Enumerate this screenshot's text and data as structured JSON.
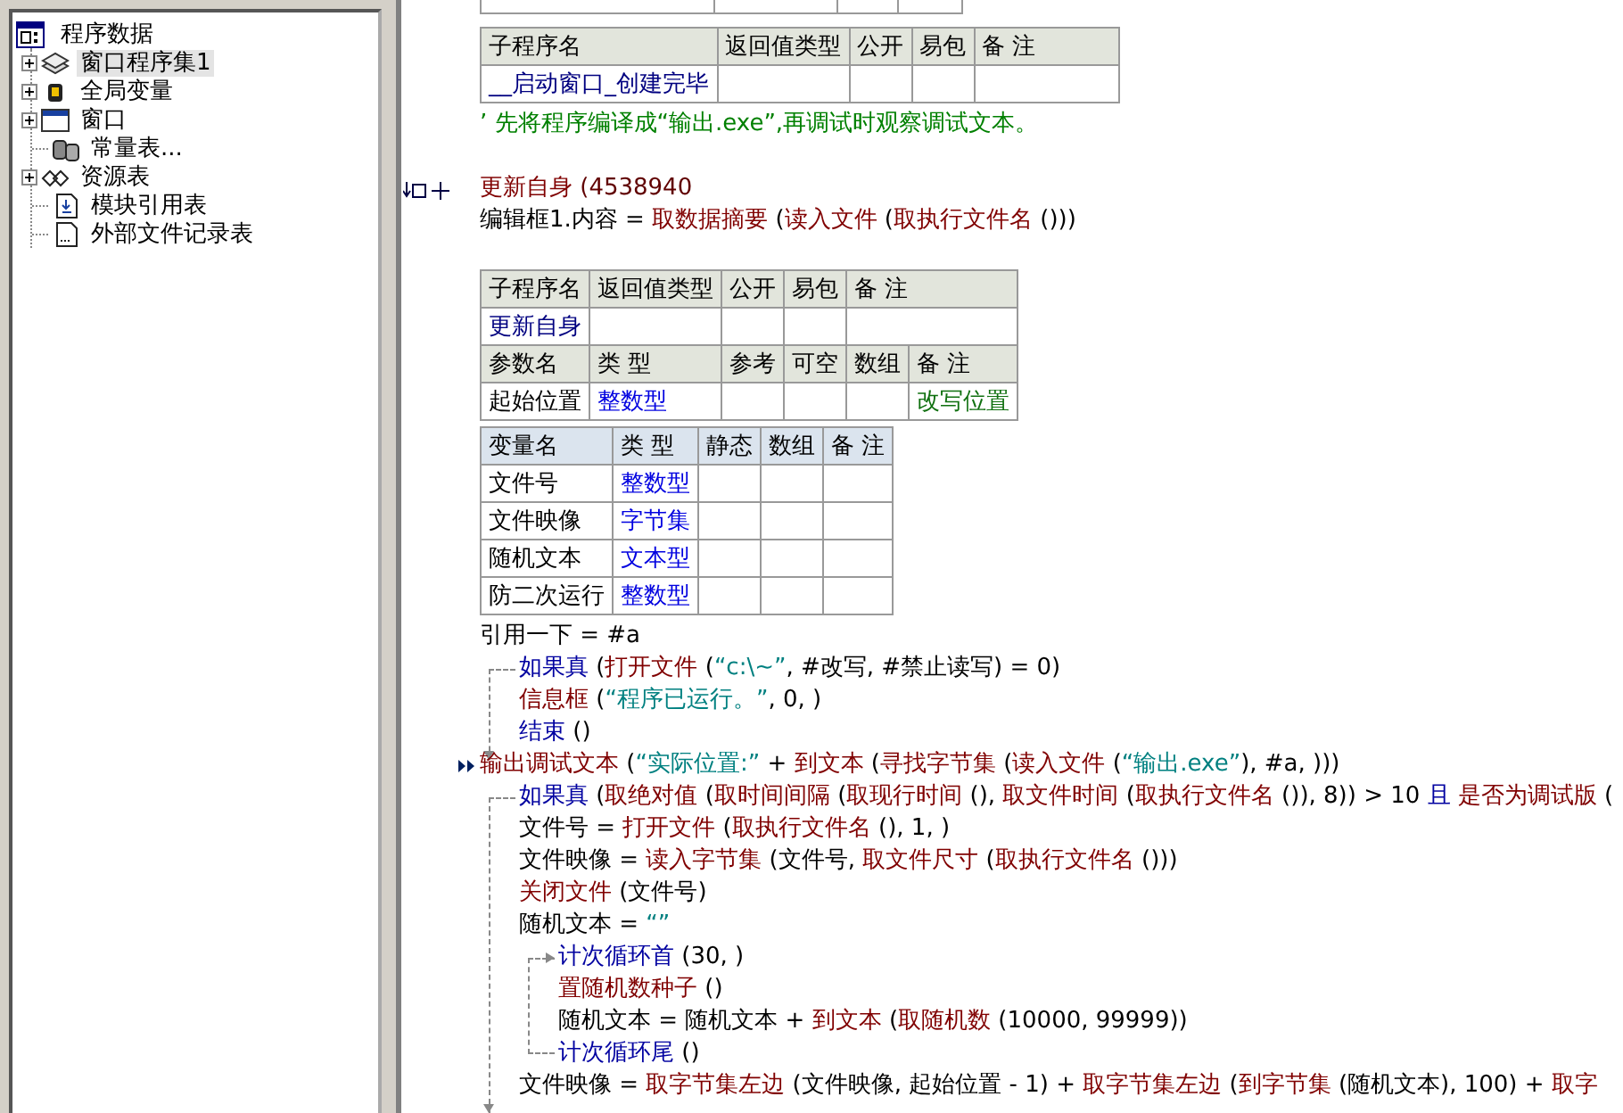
{
  "tree": {
    "root": "程序数据",
    "items": [
      {
        "label": "窗口程序集1",
        "kind": "module",
        "expandable": true,
        "selected": true
      },
      {
        "label": "全局变量",
        "kind": "variable",
        "expandable": true,
        "selected": false
      },
      {
        "label": "窗口",
        "kind": "window",
        "expandable": true,
        "selected": false
      },
      {
        "label": "常量表...",
        "kind": "constant",
        "expandable": false,
        "selected": false
      },
      {
        "label": "资源表",
        "kind": "resource",
        "expandable": true,
        "selected": false
      },
      {
        "label": "模块引用表",
        "kind": "reference",
        "expandable": false,
        "selected": false
      },
      {
        "label": "外部文件记录表",
        "kind": "file",
        "expandable": false,
        "selected": false
      }
    ]
  },
  "editor": [
    {
      "kind": "subroutine_table",
      "rows": [
        {
          "kind": "header",
          "cells": [
            {
              "text": "子程序名"
            },
            {
              "text": "返回值类型"
            },
            {
              "text": "公开"
            },
            {
              "text": "易包"
            },
            {
              "text": "备 注"
            }
          ]
        },
        {
          "kind": "data",
          "cells": [
            {
              "text": "__启动窗口_创建完毕",
              "kind": "name"
            },
            null,
            null,
            null,
            null
          ]
        }
      ]
    },
    {
      "kind": "line",
      "segments": [
        {
          "t": "’ 先将程序编译成“输出.exe”,再调试时观察调试文本。",
          "kind": "comment"
        }
      ]
    },
    {
      "kind": "blank"
    },
    {
      "kind": "line",
      "gutter": {
        "kind": "fold"
      },
      "segments": [
        {
          "t": "更新自身",
          "kind": "func"
        },
        {
          "t": " (4538940",
          "kind": "num"
        }
      ]
    },
    {
      "kind": "line",
      "segments": [
        {
          "t": "编辑框1.内容 = ",
          "kind": "plain"
        },
        {
          "t": "取数据摘要",
          "kind": "func"
        },
        {
          "t": " (",
          "kind": "plain"
        },
        {
          "t": "读入文件",
          "kind": "func"
        },
        {
          "t": " (",
          "kind": "plain"
        },
        {
          "t": "取执行文件名",
          "kind": "func"
        },
        {
          "t": " ()))",
          "kind": "plain"
        }
      ]
    },
    {
      "kind": "blank"
    },
    {
      "kind": "subroutine_table",
      "rows": [
        {
          "kind": "header",
          "cells": [
            {
              "text": "子程序名"
            },
            {
              "text": "返回值类型"
            },
            {
              "text": "公开"
            },
            {
              "text": "易包"
            },
            {
              "text": "备 注",
              "colspan": 2
            }
          ]
        },
        {
          "kind": "data",
          "cells": [
            {
              "text": "更新自身",
              "kind": "name"
            },
            null,
            null,
            null,
            {
              "colspan": 2
            }
          ]
        },
        {
          "kind": "header",
          "cells": [
            {
              "text": "参数名"
            },
            {
              "text": "类 型"
            },
            {
              "text": "参考"
            },
            {
              "text": "可空"
            },
            {
              "text": "数组"
            },
            {
              "text": "备 注"
            }
          ]
        },
        {
          "kind": "data",
          "cells": [
            {
              "text": "起始位置",
              "kind": "plain"
            },
            {
              "text": "整数型",
              "kind": "type"
            },
            null,
            null,
            null,
            {
              "text": "改写位置",
              "kind": "note"
            }
          ]
        }
      ]
    },
    {
      "kind": "variable_table",
      "rows": [
        {
          "kind": "header",
          "cells": [
            {
              "text": "变量名"
            },
            {
              "text": "类 型"
            },
            {
              "text": "静态"
            },
            {
              "text": "数组"
            },
            {
              "text": "备 注"
            }
          ]
        },
        {
          "kind": "data",
          "cells": [
            {
              "text": "文件号",
              "kind": "plain"
            },
            {
              "text": "整数型",
              "kind": "type"
            },
            null,
            null,
            null
          ]
        },
        {
          "kind": "data",
          "cells": [
            {
              "text": "文件映像",
              "kind": "plain"
            },
            {
              "text": "字节集",
              "kind": "type"
            },
            null,
            null,
            null
          ]
        },
        {
          "kind": "data",
          "cells": [
            {
              "text": "随机文本",
              "kind": "plain"
            },
            {
              "text": "文本型",
              "kind": "type"
            },
            null,
            null,
            null
          ]
        },
        {
          "kind": "data",
          "cells": [
            {
              "text": "防二次运行",
              "kind": "plain"
            },
            {
              "text": "整数型",
              "kind": "type"
            },
            null,
            null,
            null
          ]
        }
      ]
    },
    {
      "kind": "line",
      "segments": [
        {
          "t": "引用一下 = #a",
          "kind": "plain"
        }
      ]
    },
    {
      "kind": "if_block",
      "head": [
        {
          "t": "如果真",
          "kind": "flow"
        },
        {
          "t": " (",
          "kind": "plain"
        },
        {
          "t": "打开文件",
          "kind": "func"
        },
        {
          "t": " (",
          "kind": "plain"
        },
        {
          "t": "“c:\\~”",
          "kind": "str"
        },
        {
          "t": ", #改写, #禁止读写) = 0)",
          "kind": "plain"
        }
      ],
      "children": [
        {
          "kind": "line",
          "segments": [
            {
              "t": "信息框",
              "kind": "func"
            },
            {
              "t": " (",
              "kind": "plain"
            },
            {
              "t": "“程序已运行。”",
              "kind": "str"
            },
            {
              "t": ", 0, )",
              "kind": "plain"
            }
          ]
        },
        {
          "kind": "line",
          "segments": [
            {
              "t": "结束",
              "kind": "flow"
            },
            {
              "t": " ()",
              "kind": "plain"
            }
          ]
        }
      ]
    },
    {
      "kind": "line",
      "gutter": {
        "kind": "run"
      },
      "segments": [
        {
          "t": "输出调试文本",
          "kind": "func"
        },
        {
          "t": " (",
          "kind": "plain"
        },
        {
          "t": "“实际位置:”",
          "kind": "str"
        },
        {
          "t": " + ",
          "kind": "plain"
        },
        {
          "t": "到文本",
          "kind": "func"
        },
        {
          "t": " (",
          "kind": "plain"
        },
        {
          "t": "寻找字节集",
          "kind": "func"
        },
        {
          "t": " (",
          "kind": "plain"
        },
        {
          "t": "读入文件",
          "kind": "func"
        },
        {
          "t": " (",
          "kind": "plain"
        },
        {
          "t": "“输出.exe”",
          "kind": "str"
        },
        {
          "t": "), #a, )))",
          "kind": "plain"
        }
      ]
    },
    {
      "kind": "if_block",
      "head": [
        {
          "t": "如果真",
          "kind": "flow"
        },
        {
          "t": " (",
          "kind": "plain"
        },
        {
          "t": "取绝对值",
          "kind": "func"
        },
        {
          "t": " (",
          "kind": "plain"
        },
        {
          "t": "取时间间隔",
          "kind": "func"
        },
        {
          "t": " (",
          "kind": "plain"
        },
        {
          "t": "取现行时间",
          "kind": "func"
        },
        {
          "t": " (), ",
          "kind": "plain"
        },
        {
          "t": "取文件时间",
          "kind": "func"
        },
        {
          "t": " (",
          "kind": "plain"
        },
        {
          "t": "取执行文件名",
          "kind": "func"
        },
        {
          "t": " ()), 8)) > 10 ",
          "kind": "plain"
        },
        {
          "t": "且 ",
          "kind": "flow"
        },
        {
          "t": "是否为调试版",
          "kind": "func"
        },
        {
          "t": " (",
          "kind": "plain"
        }
      ],
      "children": [
        {
          "kind": "line",
          "segments": [
            {
              "t": "文件号 = ",
              "kind": "plain"
            },
            {
              "t": "打开文件",
              "kind": "func"
            },
            {
              "t": " (",
              "kind": "plain"
            },
            {
              "t": "取执行文件名",
              "kind": "func"
            },
            {
              "t": " (), 1, )",
              "kind": "plain"
            }
          ]
        },
        {
          "kind": "line",
          "segments": [
            {
              "t": "文件映像 = ",
              "kind": "plain"
            },
            {
              "t": "读入字节集",
              "kind": "func"
            },
            {
              "t": " (文件号, ",
              "kind": "plain"
            },
            {
              "t": "取文件尺寸",
              "kind": "func"
            },
            {
              "t": " (",
              "kind": "plain"
            },
            {
              "t": "取执行文件名",
              "kind": "func"
            },
            {
              "t": " ()))",
              "kind": "plain"
            }
          ]
        },
        {
          "kind": "line",
          "segments": [
            {
              "t": "关闭文件",
              "kind": "func"
            },
            {
              "t": " (文件号)",
              "kind": "plain"
            }
          ]
        },
        {
          "kind": "line",
          "segments": [
            {
              "t": "随机文本 = ",
              "kind": "plain"
            },
            {
              "t": "“”",
              "kind": "str"
            }
          ]
        },
        {
          "kind": "loop_block",
          "head": [
            {
              "t": "计次循环首",
              "kind": "flow"
            },
            {
              "t": " (30, )",
              "kind": "plain"
            }
          ],
          "children": [
            {
              "kind": "line",
              "segments": [
                {
                  "t": "置随机数种子",
                  "kind": "func"
                },
                {
                  "t": " ()",
                  "kind": "plain"
                }
              ]
            },
            {
              "kind": "line",
              "segments": [
                {
                  "t": "随机文本 = 随机文本 + ",
                  "kind": "plain"
                },
                {
                  "t": "到文本",
                  "kind": "func"
                },
                {
                  "t": " (",
                  "kind": "plain"
                },
                {
                  "t": "取随机数",
                  "kind": "func"
                },
                {
                  "t": " (10000, 99999))",
                  "kind": "plain"
                }
              ]
            }
          ],
          "tail": [
            {
              "t": "计次循环尾",
              "kind": "flow"
            },
            {
              "t": " ()",
              "kind": "plain"
            }
          ]
        },
        {
          "kind": "line",
          "segments": [
            {
              "t": "文件映像 = ",
              "kind": "plain"
            },
            {
              "t": "取字节集左边",
              "kind": "func"
            },
            {
              "t": " (文件映像, 起始位置 - 1) + ",
              "kind": "plain"
            },
            {
              "t": "取字节集左边",
              "kind": "func"
            },
            {
              "t": " (",
              "kind": "plain"
            },
            {
              "t": "到字节集",
              "kind": "func"
            },
            {
              "t": " (随机文本), 100) + ",
              "kind": "plain"
            },
            {
              "t": "取字",
              "kind": "func"
            }
          ]
        }
      ]
    }
  ]
}
